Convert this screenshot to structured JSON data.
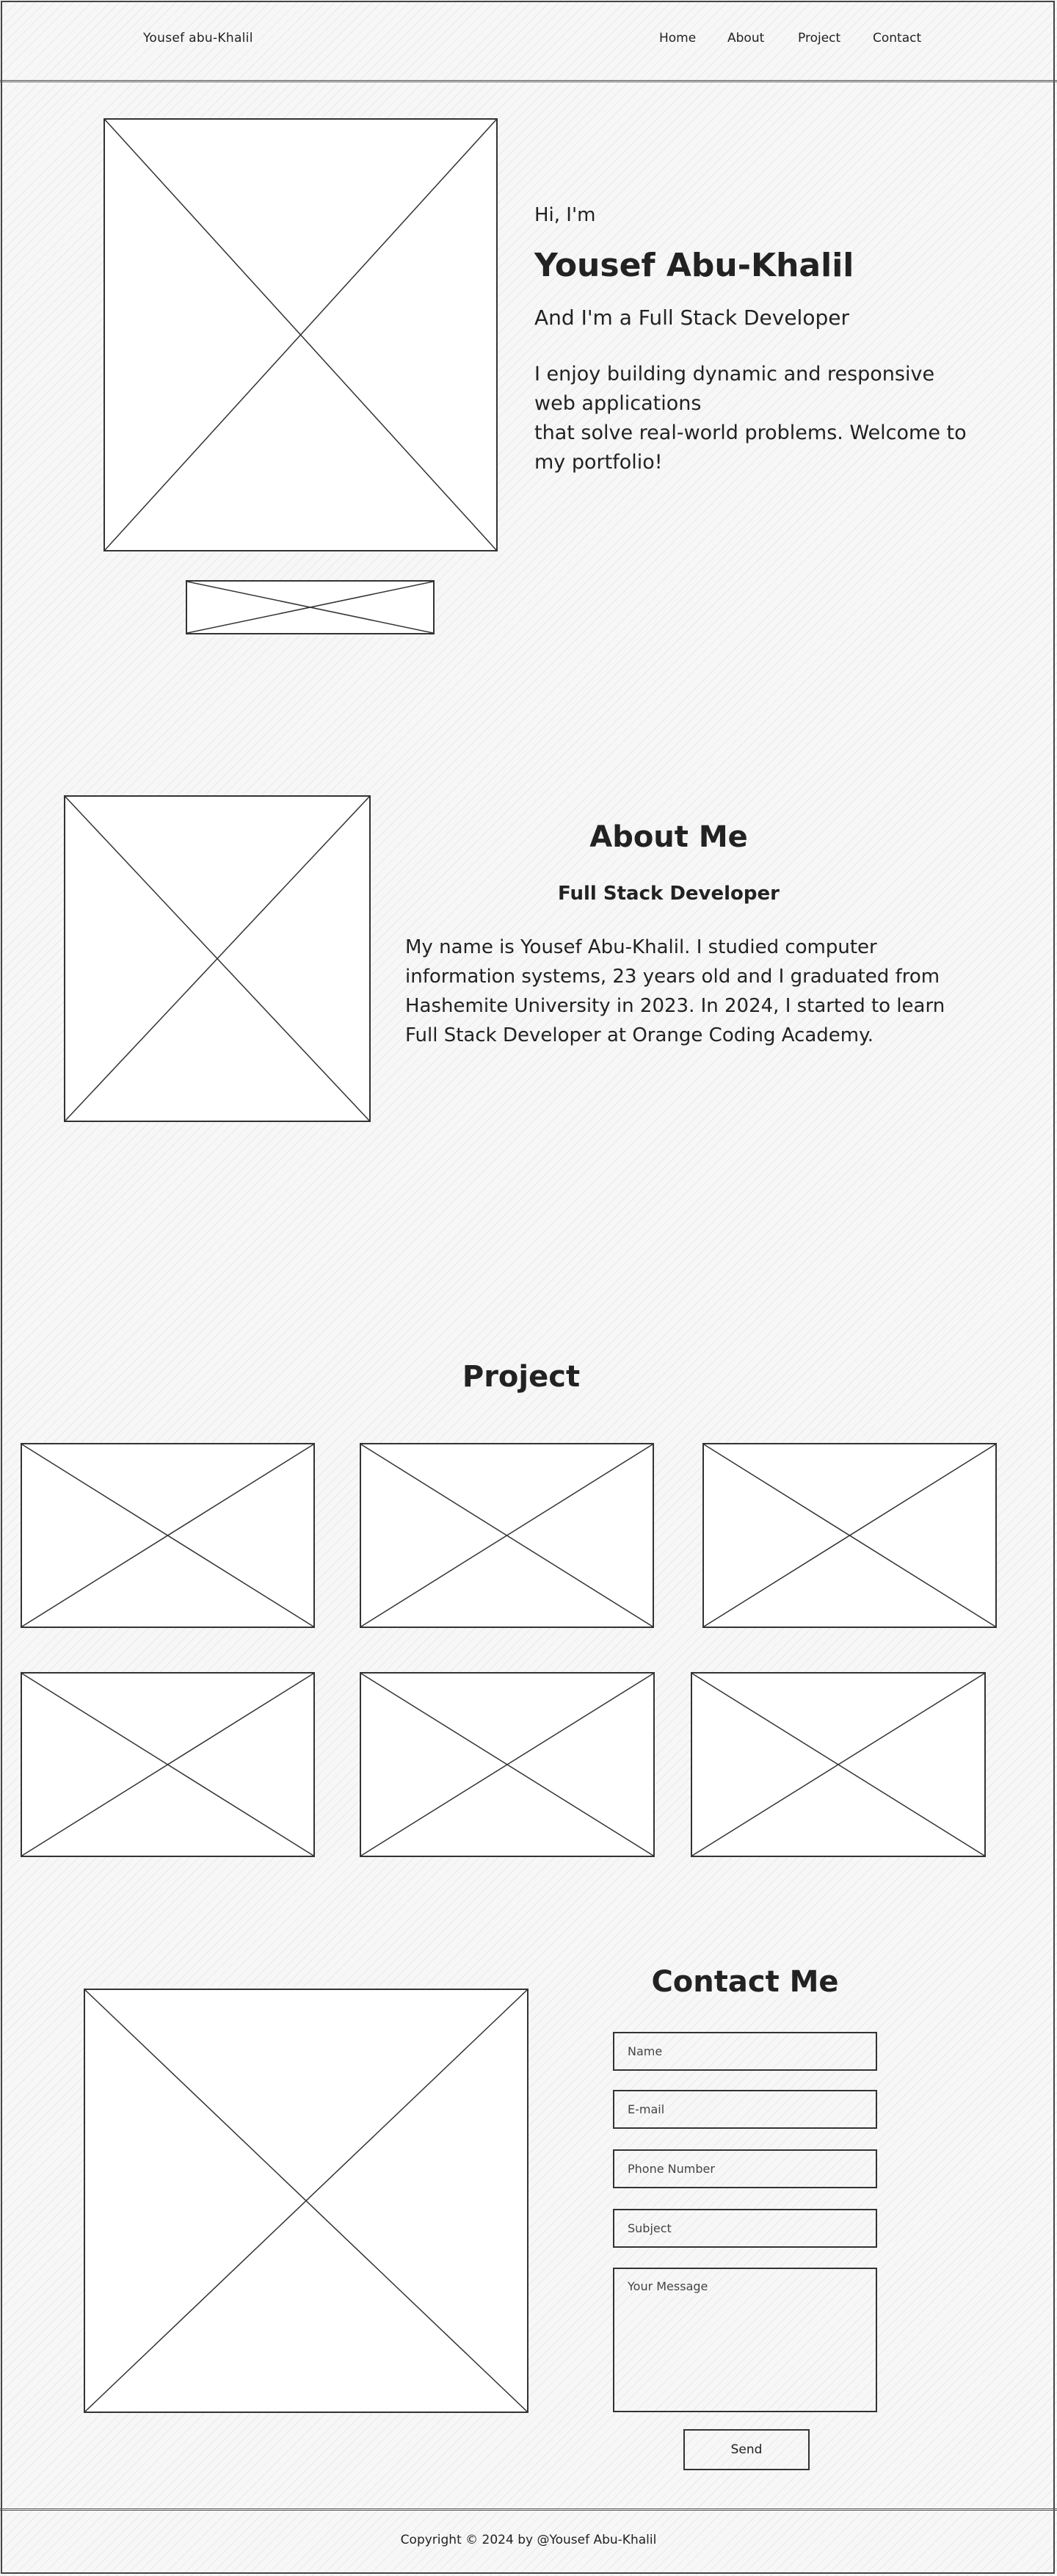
{
  "header": {
    "brand": "Yousef abu-Khalil",
    "nav": [
      "Home",
      "About",
      "Project",
      "Contact"
    ]
  },
  "hero": {
    "greeting": "Hi, I'm",
    "name": "Yousef Abu-Khalil",
    "role": "And I'm a Full Stack Developer",
    "bio_line1": "I enjoy building dynamic and responsive web applications",
    "bio_line2": "that solve real-world problems. Welcome to my portfolio!"
  },
  "about": {
    "title": "About Me",
    "subtitle": "Full Stack Developer",
    "text": "My name is Yousef Abu-Khalil. I studied computer information systems, 23 years old and I graduated from Hashemite University in 2023. In 2024, I started to learn Full Stack Developer at Orange Coding Academy."
  },
  "projects": {
    "title": "Project"
  },
  "contact": {
    "title": "Contact Me",
    "placeholders": {
      "name": "Name",
      "email": "E-mail",
      "phone": "Phone Number",
      "subject": "Subject",
      "message": "Your Message"
    },
    "send_label": "Send"
  },
  "footer": {
    "copyright": "Copyright © 2024 by @Yousef Abu-Khalil"
  }
}
